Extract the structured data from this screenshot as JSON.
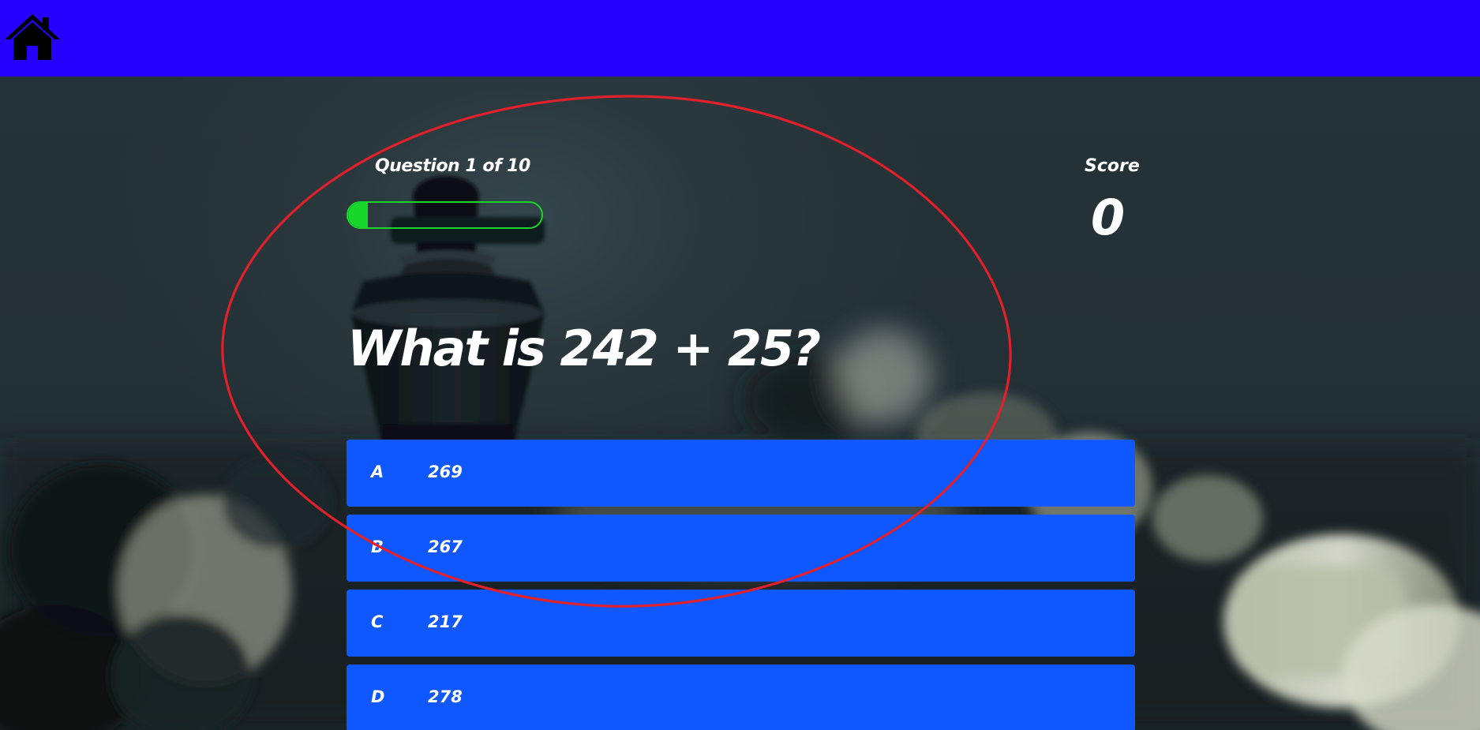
{
  "nav": {
    "home_icon": "home-icon",
    "colors": {
      "bar": "#2600ff",
      "icon": "#000000"
    }
  },
  "quiz": {
    "progress_text": "Question 1 of 10",
    "progress_fraction": 0.1,
    "score_label": "Score",
    "score_value": "0",
    "question": "What is 242 + 25?",
    "answers": [
      {
        "letter": "A",
        "value": "269"
      },
      {
        "letter": "B",
        "value": "267"
      },
      {
        "letter": "C",
        "value": "217"
      },
      {
        "letter": "D",
        "value": "278"
      }
    ],
    "colors": {
      "answer_bg": "#0f58ff",
      "progress": "#18d62b",
      "text": "#ffffff"
    }
  },
  "annotation": {
    "shape": "ellipse",
    "color": "#e0202a"
  }
}
